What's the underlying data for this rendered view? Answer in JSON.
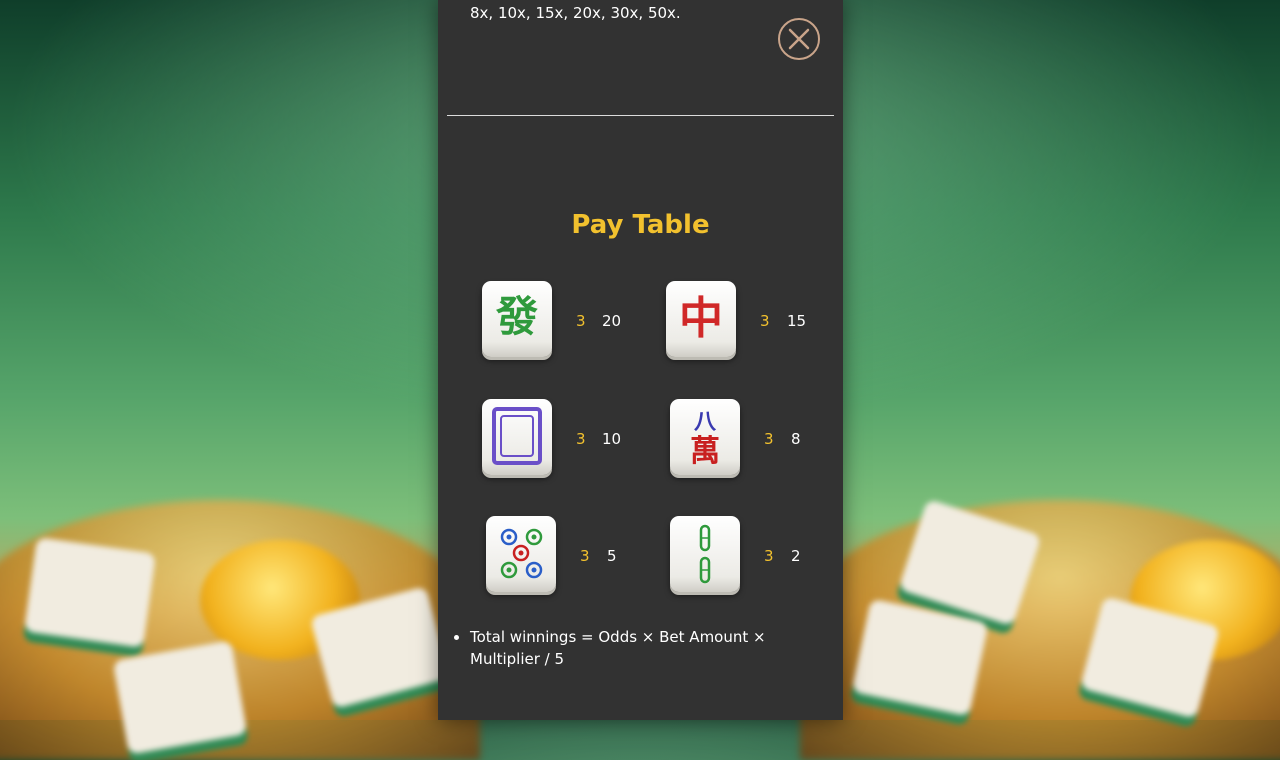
{
  "previous_text": "8x, 10x, 15x, 20x, 30x, 50x.",
  "close_icon": "close-icon",
  "title": "Pay Table",
  "paytable": [
    {
      "symbol": "fa-tile-green",
      "count": "3",
      "payout": "20"
    },
    {
      "symbol": "zhong-tile-red",
      "count": "3",
      "payout": "15"
    },
    {
      "symbol": "white-dragon-tile",
      "count": "3",
      "payout": "10"
    },
    {
      "symbol": "eight-wan-tile",
      "count": "3",
      "payout": "8"
    },
    {
      "symbol": "five-circles-tile",
      "count": "3",
      "payout": "5"
    },
    {
      "symbol": "two-bamboo-tile",
      "count": "3",
      "payout": "2"
    }
  ],
  "formula": "Total winnings = Odds × Bet Amount × Multiplier / 5",
  "colors": {
    "accent": "#f2c12e",
    "panel": "#323232",
    "text": "#ffffff"
  }
}
